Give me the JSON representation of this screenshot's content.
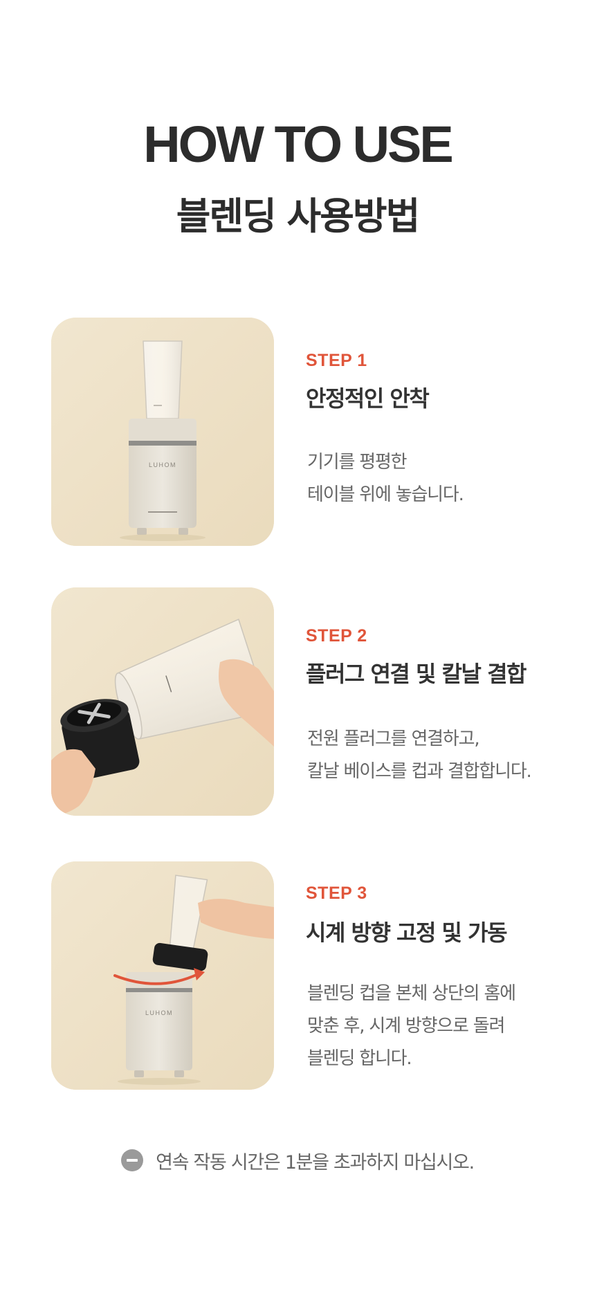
{
  "header": {
    "title_en": "HOW TO USE",
    "title_ko": "블렌딩 사용방법"
  },
  "steps": [
    {
      "label": "STEP 1",
      "title": "안정적인 안착",
      "desc": [
        "기기를 평평한",
        "테이블 위에 놓습니다."
      ],
      "image_brand": "LUHOM"
    },
    {
      "label": "STEP 2",
      "title": "플러그 연결 및 칼날 결합",
      "desc": [
        "전원 플러그를 연결하고,",
        "칼날 베이스를 컵과 결합합니다."
      ]
    },
    {
      "label": "STEP 3",
      "title": "시계 방향 고정 및 가동",
      "desc": [
        "블렌딩 컵을 본체 상단의 홈에",
        "맞춘 후, 시계 방향으로 돌려",
        "블렌딩 합니다."
      ],
      "image_brand": "LUHOM"
    }
  ],
  "notice": {
    "icon": "minus-circle-icon",
    "text": "연속 작동 시간은 1분을 초과하지 마십시오."
  },
  "colors": {
    "accent": "#e0553a",
    "photo_bg": "#efe3c9",
    "text_dark": "#333333",
    "text_gray": "#666666"
  }
}
